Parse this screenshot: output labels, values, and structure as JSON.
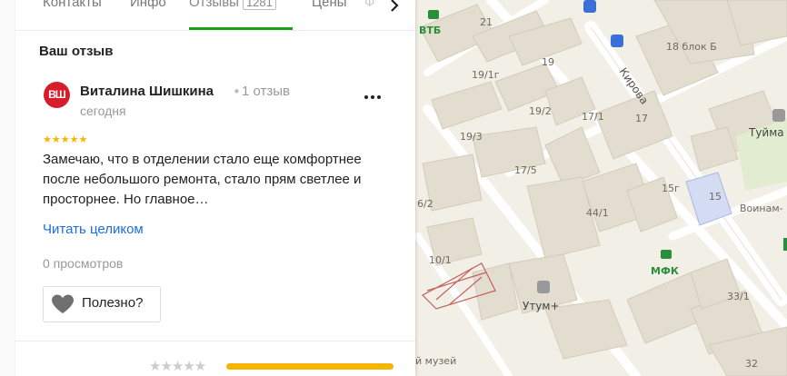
{
  "panel": {
    "tabs": [
      {
        "label": "Контакты"
      },
      {
        "label": "Инфо"
      },
      {
        "label": "Отзывы",
        "count": "1281"
      },
      {
        "label": "Цены"
      },
      {
        "label": "Ф"
      }
    ],
    "section_title": "Ваш отзыв",
    "review": {
      "avatar_initials": "ВШ",
      "author": "Виталина Шишкина",
      "separator": "•",
      "review_count": "1 отзыв",
      "date": "сегодня",
      "stars_text": "★★★★★",
      "text": "Замечаю, что в отделении стало еще комфортнее после небольшого ремонта, стало прям светлее и просторнее. Но главное…",
      "read_more": "Читать целиком",
      "views": "0 просмотров",
      "useful_label": "Полезно?"
    },
    "rating_row": {
      "stars_text": "★★★★★",
      "bar_fraction": 1.0
    }
  },
  "map": {
    "streets": [
      {
        "name": "Кирова"
      }
    ],
    "pois": [
      {
        "name": "ВТБ",
        "type": "bank"
      },
      {
        "name": "МФК",
        "type": "bank"
      },
      {
        "name": "Утум+",
        "type": "shop"
      },
      {
        "name": "Туйма",
        "type": "shop"
      },
      {
        "name": "Воинам-",
        "type": "monument"
      },
      {
        "name": "й музей",
        "type": "museum"
      }
    ],
    "building_numbers": [
      "21",
      "19",
      "19/1г",
      "19/2",
      "19/3",
      "17/1",
      "17",
      "17/5",
      "18 блок Б",
      "15г",
      "15",
      "44/1",
      "6/2",
      "10/1",
      "33/1",
      "32"
    ]
  },
  "colors": {
    "accent_green": "#19a11b",
    "link_blue": "#1a6fe0",
    "star_yellow": "#f7b500",
    "avatar_red": "#d81d2a",
    "map_bg": "#f2efe6",
    "building": "#e3ddd0"
  }
}
